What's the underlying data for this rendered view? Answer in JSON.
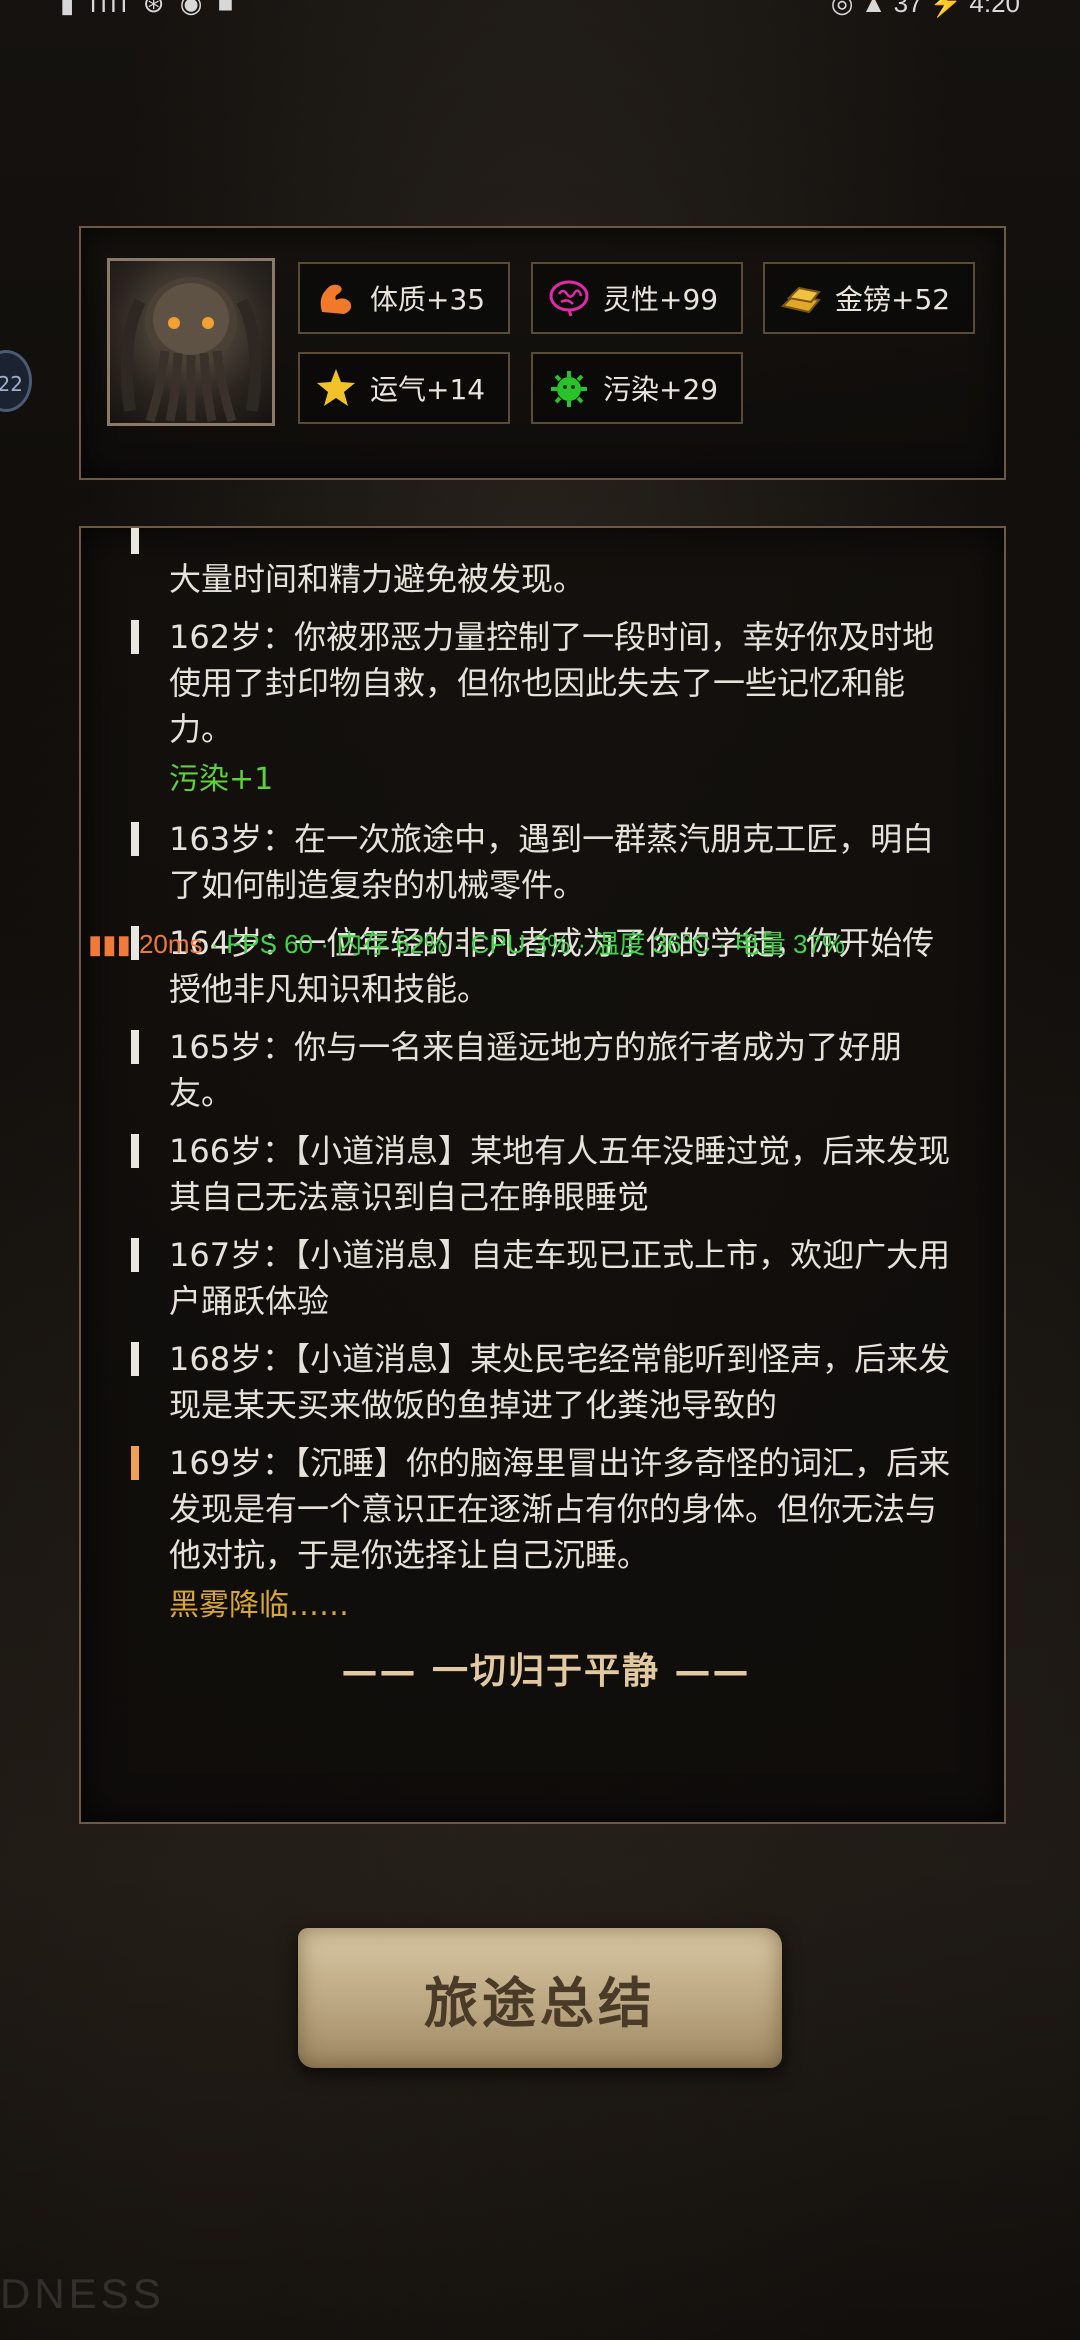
{
  "status_bar": {
    "left": "▮ ıllı ⊛ ◉ ■",
    "right": "◎ ▲ 37 ⚡ 4:20"
  },
  "floating_badge": "22",
  "stats": [
    {
      "icon": "muscle-icon",
      "label": "体质+35",
      "color": "#f07a2a"
    },
    {
      "icon": "brain-icon",
      "label": "灵性+99",
      "color": "#e02aa8"
    },
    {
      "icon": "gold-bars-icon",
      "label": "金镑+52",
      "color": "#e0a82a"
    },
    {
      "icon": "star-icon",
      "label": "运气+14",
      "color": "#f2c22a"
    },
    {
      "icon": "virus-icon",
      "label": "污染+29",
      "color": "#2ac22a"
    }
  ],
  "log": {
    "partial_top": "大量时间和精力避免被发现。",
    "entries": [
      {
        "text": "162岁：你被邪恶力量控制了一段时间，幸好你及时地使用了封印物自救，但你也因此失去了一些记忆和能力。",
        "effect": "污染+1"
      },
      {
        "text": "163岁：在一次旅途中，遇到一群蒸汽朋克工匠，明白了如何制造复杂的机械零件。"
      },
      {
        "text": "164岁：一位年轻的非凡者成为了你的学徒，你开始传授他非凡知识和技能。"
      },
      {
        "text": "165岁：你与一名来自遥远地方的旅行者成为了好朋友。"
      },
      {
        "text": "166岁：【小道消息】某地有人五年没睡过觉，后来发现其自己无法意识到自己在睁眼睡觉"
      },
      {
        "text": "167岁：【小道消息】自走车现已正式上市，欢迎广大用户踊跃体验"
      },
      {
        "text": "168岁：【小道消息】某处民宅经常能听到怪声，后来发现是某天买来做饭的鱼掉进了化粪池导致的"
      },
      {
        "text": "169岁：【沉睡】你的脑海里冒出许多奇怪的词汇，后来发现是有一个意识正在逐渐占有你的身体。但你无法与他对抗，于是你选择让自己沉睡。",
        "effect": "黑雾降临……",
        "highlight": true
      }
    ],
    "end_text": "—— 一切归于平静 ——"
  },
  "fps_overlay": {
    "ms": "20ms",
    "stats": "· FPS 60 · 内存 62% · CPU 3% · 温度 36°C · 电量 37%"
  },
  "summary_button": "旅途总结",
  "watermark": "DNESS"
}
